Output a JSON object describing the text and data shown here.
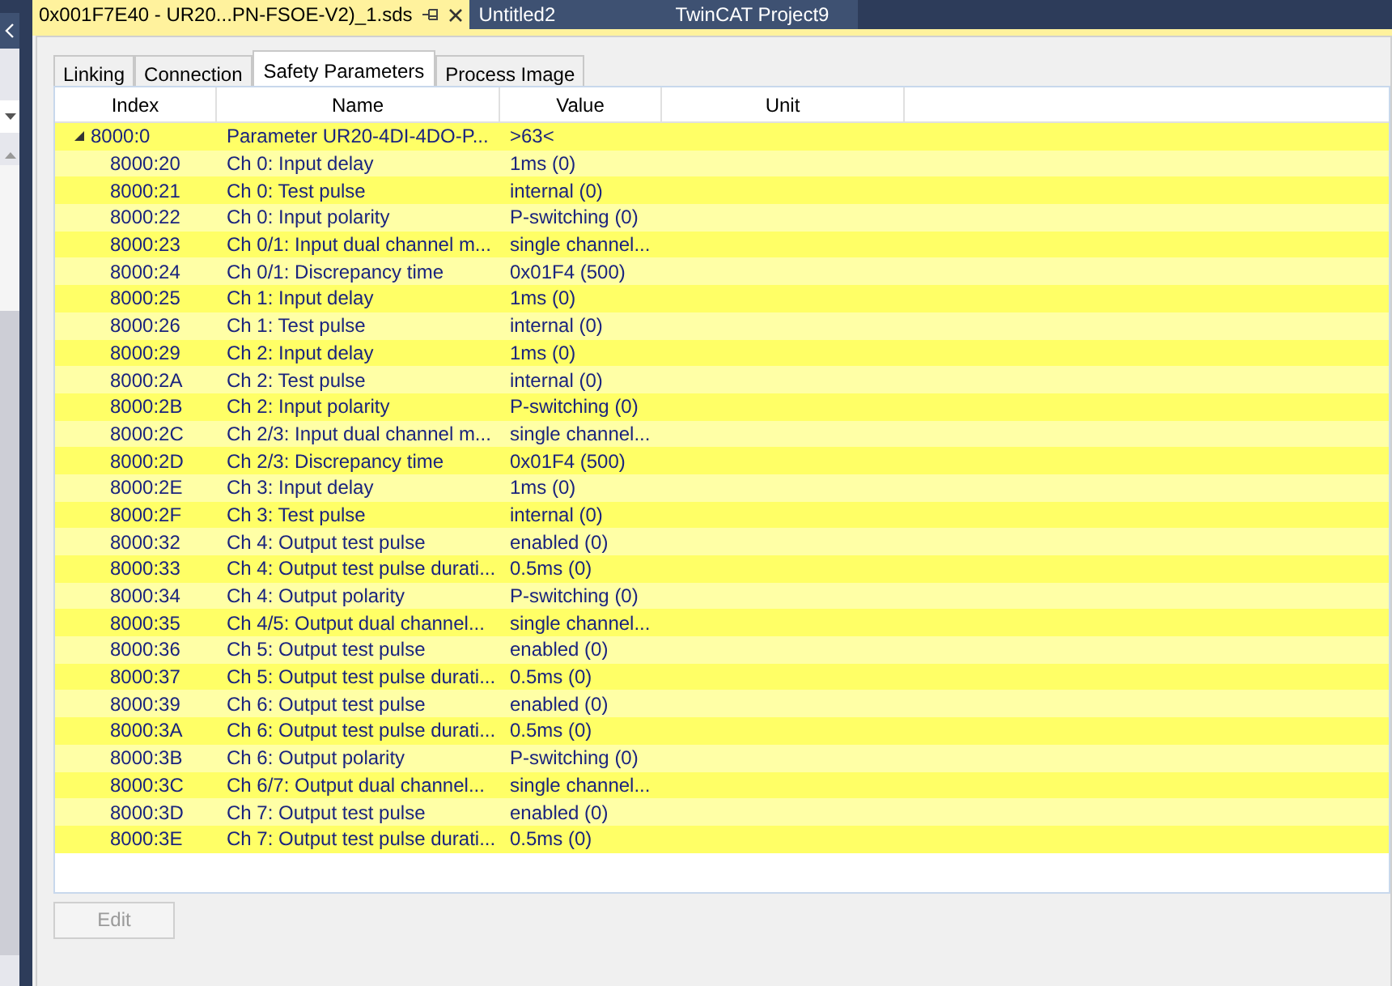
{
  "doc_tabs": [
    {
      "label": "0x001F7E40 - UR20...PN-FSOE-V2)_1.sds",
      "selected": true
    },
    {
      "label": "Untitled2",
      "selected": false
    },
    {
      "label": "TwinCAT Project9",
      "selected": false
    }
  ],
  "tabs": [
    {
      "label": "Linking",
      "selected": false
    },
    {
      "label": "Connection",
      "selected": false
    },
    {
      "label": "Safety Parameters",
      "selected": true
    },
    {
      "label": "Process Image",
      "selected": false
    }
  ],
  "table": {
    "columns": [
      "Index",
      "Name",
      "Value",
      "Unit"
    ],
    "rows": [
      {
        "index": "8000:0",
        "name": "Parameter UR20-4DI-4DO-P...",
        "value": ">63<",
        "expanded": true,
        "children": [
          {
            "index": "8000:20",
            "name": "Ch 0: Input delay",
            "value": "1ms (0)"
          },
          {
            "index": "8000:21",
            "name": "Ch 0: Test pulse",
            "value": "internal (0)"
          },
          {
            "index": "8000:22",
            "name": "Ch 0: Input polarity",
            "value": "P-switching (0)"
          },
          {
            "index": "8000:23",
            "name": "Ch 0/1: Input dual channel m...",
            "value": "single channel..."
          },
          {
            "index": "8000:24",
            "name": "Ch 0/1: Discrepancy time",
            "value": "0x01F4 (500)"
          },
          {
            "index": "8000:25",
            "name": "Ch 1: Input delay",
            "value": "1ms (0)"
          },
          {
            "index": "8000:26",
            "name": "Ch 1: Test pulse",
            "value": "internal (0)"
          },
          {
            "index": "8000:29",
            "name": "Ch 2: Input delay",
            "value": "1ms (0)"
          },
          {
            "index": "8000:2A",
            "name": "Ch 2: Test pulse",
            "value": "internal (0)"
          },
          {
            "index": "8000:2B",
            "name": "Ch 2: Input polarity",
            "value": "P-switching (0)"
          },
          {
            "index": "8000:2C",
            "name": "Ch 2/3: Input dual channel m...",
            "value": "single channel..."
          },
          {
            "index": "8000:2D",
            "name": "Ch 2/3: Discrepancy time",
            "value": "0x01F4 (500)"
          },
          {
            "index": "8000:2E",
            "name": "Ch 3: Input delay",
            "value": "1ms (0)"
          },
          {
            "index": "8000:2F",
            "name": "Ch 3: Test pulse",
            "value": "internal (0)"
          },
          {
            "index": "8000:32",
            "name": "Ch 4: Output test pulse",
            "value": "enabled (0)"
          },
          {
            "index": "8000:33",
            "name": "Ch 4: Output test pulse durati...",
            "value": "0.5ms (0)"
          },
          {
            "index": "8000:34",
            "name": "Ch 4: Output polarity",
            "value": "P-switching (0)"
          },
          {
            "index": "8000:35",
            "name": "Ch 4/5: Output dual channel...",
            "value": "single channel..."
          },
          {
            "index": "8000:36",
            "name": "Ch 5: Output test pulse",
            "value": "enabled (0)"
          },
          {
            "index": "8000:37",
            "name": "Ch 5: Output test pulse durati...",
            "value": "0.5ms (0)"
          },
          {
            "index": "8000:39",
            "name": "Ch 6: Output test pulse",
            "value": "enabled (0)"
          },
          {
            "index": "8000:3A",
            "name": "Ch 6: Output test pulse durati...",
            "value": "0.5ms (0)"
          },
          {
            "index": "8000:3B",
            "name": "Ch 6: Output polarity",
            "value": "P-switching (0)"
          },
          {
            "index": "8000:3C",
            "name": "Ch 6/7: Output dual channel...",
            "value": "single channel..."
          },
          {
            "index": "8000:3D",
            "name": "Ch 7: Output test pulse",
            "value": "enabled (0)"
          },
          {
            "index": "8000:3E",
            "name": "Ch 7: Output test pulse durati...",
            "value": "0.5ms (0)"
          }
        ]
      }
    ]
  },
  "edit_button": {
    "label": "Edit",
    "disabled": true
  }
}
